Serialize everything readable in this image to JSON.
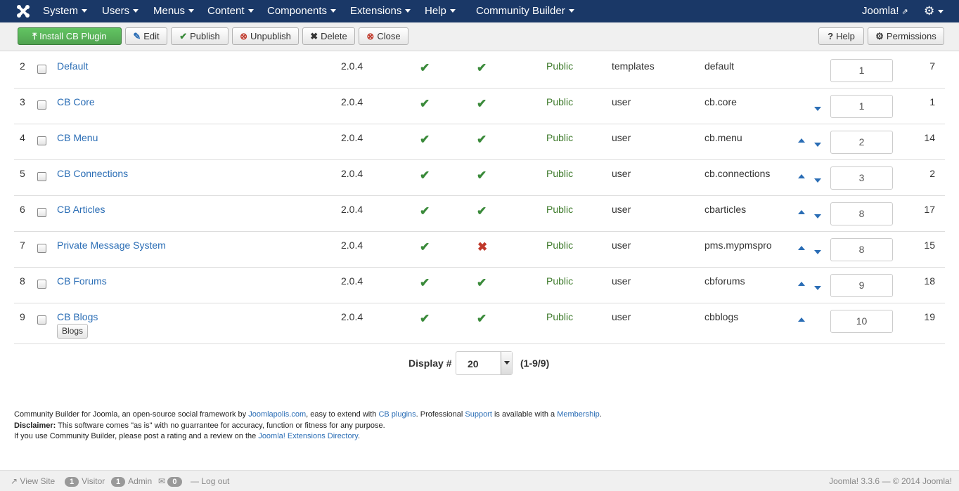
{
  "nav": {
    "system": "System",
    "users": "Users",
    "menus": "Menus",
    "content": "Content",
    "components": "Components",
    "extensions": "Extensions",
    "help": "Help",
    "community_builder": "Community Builder",
    "joomla": "Joomla!"
  },
  "toolbar": {
    "install": "Install CB Plugin",
    "edit": "Edit",
    "publish": "Publish",
    "unpublish": "Unpublish",
    "delete": "Delete",
    "close": "Close",
    "help": "Help",
    "permissions": "Permissions"
  },
  "rows": [
    {
      "num": "2",
      "name": "Default",
      "version": "2.0.4",
      "published": true,
      "compatible": true,
      "access": "Public",
      "type": "templates",
      "element": "default",
      "up": false,
      "down": false,
      "order": "1",
      "id": "7"
    },
    {
      "num": "3",
      "name": "CB Core",
      "version": "2.0.4",
      "published": true,
      "compatible": true,
      "access": "Public",
      "type": "user",
      "element": "cb.core",
      "up": false,
      "down": true,
      "order": "1",
      "id": "1"
    },
    {
      "num": "4",
      "name": "CB Menu",
      "version": "2.0.4",
      "published": true,
      "compatible": true,
      "access": "Public",
      "type": "user",
      "element": "cb.menu",
      "up": true,
      "down": true,
      "order": "2",
      "id": "14"
    },
    {
      "num": "5",
      "name": "CB Connections",
      "version": "2.0.4",
      "published": true,
      "compatible": true,
      "access": "Public",
      "type": "user",
      "element": "cb.connections",
      "up": true,
      "down": true,
      "order": "3",
      "id": "2"
    },
    {
      "num": "6",
      "name": "CB Articles",
      "version": "2.0.4",
      "published": true,
      "compatible": true,
      "access": "Public",
      "type": "user",
      "element": "cbarticles",
      "up": true,
      "down": true,
      "order": "8",
      "id": "17"
    },
    {
      "num": "7",
      "name": "Private Message System",
      "version": "2.0.4",
      "published": true,
      "compatible": false,
      "access": "Public",
      "type": "user",
      "element": "pms.mypmspro",
      "up": true,
      "down": true,
      "order": "8",
      "id": "15"
    },
    {
      "num": "8",
      "name": "CB Forums",
      "version": "2.0.4",
      "published": true,
      "compatible": true,
      "access": "Public",
      "type": "user",
      "element": "cbforums",
      "up": true,
      "down": true,
      "order": "9",
      "id": "18"
    },
    {
      "num": "9",
      "name": "CB Blogs",
      "version": "2.0.4",
      "published": true,
      "compatible": true,
      "access": "Public",
      "type": "user",
      "element": "cbblogs",
      "up": true,
      "down": false,
      "order": "10",
      "id": "19",
      "tag": "Blogs"
    }
  ],
  "pagination": {
    "display_label": "Display #",
    "display_value": "20",
    "count": "(1-9/9)"
  },
  "footer": {
    "line1_a": "Community Builder for Joomla, an open-source social framework by ",
    "link_joomlapolis": "Joomlapolis.com",
    "line1_b": ", easy to extend with ",
    "link_cb_plugins": "CB plugins",
    "line1_c": ". Professional ",
    "link_support": "Support",
    "line1_d": " is available with a ",
    "link_membership": "Membership",
    "line1_e": ".",
    "disclaimer_label": "Disclaimer:",
    "disclaimer_text": " This software comes \"as is\" with no guarrantee for accuracy, function or fitness for any purpose.",
    "line3_a": "If you use Community Builder, please post a rating and a review on the ",
    "link_jed": "Joomla! Extensions Directory",
    "line3_b": "."
  },
  "statusbar": {
    "view_site": "View Site",
    "visitor_count": "1",
    "visitor_label": "Visitor",
    "admin_count": "1",
    "admin_label": "Admin",
    "messages_count": "0",
    "logout": "Log out",
    "version": "Joomla! 3.3.6 — © 2014 Joomla!"
  }
}
